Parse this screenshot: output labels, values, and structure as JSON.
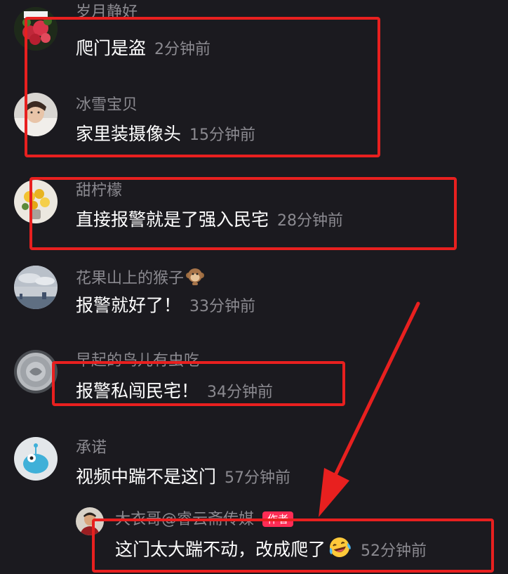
{
  "comments": [
    {
      "username": "岁月静好",
      "text": "爬门是盗",
      "time": "2分钟前",
      "avatar": "flower-bouquet-avatar"
    },
    {
      "username": "冰雪宝贝",
      "text": "家里装摄像头",
      "time": "15分钟前",
      "avatar": "baby-photo-avatar"
    },
    {
      "username": "甜柠檬",
      "text": "直接报警就是了强入民宅",
      "time": "28分钟前",
      "avatar": "yellow-flowers-avatar"
    },
    {
      "username": "花果山上的猴子",
      "text": "报警就好了！",
      "time": "33分钟前",
      "avatar": "cloudy-sky-avatar",
      "name_emoji": "monkey-emoji"
    },
    {
      "username": "早起的鸟儿有虫吃",
      "text": "报警私闯民宅！",
      "time": "34分钟前",
      "avatar": "silver-coin-avatar"
    },
    {
      "username": "承诺",
      "text": "视频中踹不是这门",
      "time": "57分钟前",
      "avatar": "blue-cartoon-avatar"
    }
  ],
  "reply": {
    "username": "大衣哥@睿云斋传媒",
    "badge": "作者",
    "text": "这门太大踹不动，改成爬了",
    "text_emoji": "laughing-crying-emoji",
    "time": "52分钟前",
    "avatar": "man-portrait-avatar"
  },
  "colors": {
    "background": "#1b1a1f",
    "username": "#8b8a90",
    "content": "#ffffff",
    "badge": "#fe2c55",
    "annotation": "#e8201f"
  }
}
